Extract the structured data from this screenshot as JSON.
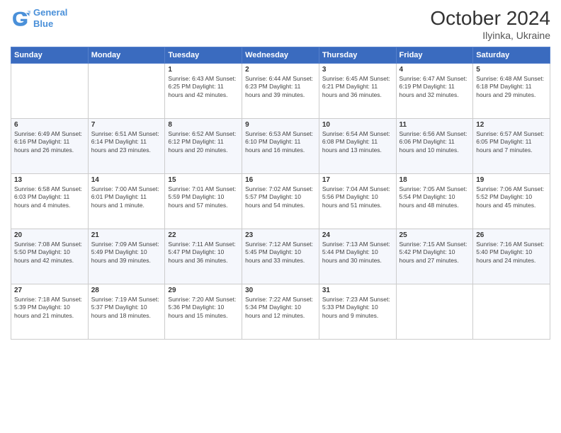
{
  "header": {
    "logo_line1": "General",
    "logo_line2": "Blue",
    "month": "October 2024",
    "location": "Ilyinka, Ukraine"
  },
  "days_of_week": [
    "Sunday",
    "Monday",
    "Tuesday",
    "Wednesday",
    "Thursday",
    "Friday",
    "Saturday"
  ],
  "weeks": [
    [
      {
        "day": "",
        "info": ""
      },
      {
        "day": "",
        "info": ""
      },
      {
        "day": "1",
        "info": "Sunrise: 6:43 AM\nSunset: 6:25 PM\nDaylight: 11 hours and 42 minutes."
      },
      {
        "day": "2",
        "info": "Sunrise: 6:44 AM\nSunset: 6:23 PM\nDaylight: 11 hours and 39 minutes."
      },
      {
        "day": "3",
        "info": "Sunrise: 6:45 AM\nSunset: 6:21 PM\nDaylight: 11 hours and 36 minutes."
      },
      {
        "day": "4",
        "info": "Sunrise: 6:47 AM\nSunset: 6:19 PM\nDaylight: 11 hours and 32 minutes."
      },
      {
        "day": "5",
        "info": "Sunrise: 6:48 AM\nSunset: 6:18 PM\nDaylight: 11 hours and 29 minutes."
      }
    ],
    [
      {
        "day": "6",
        "info": "Sunrise: 6:49 AM\nSunset: 6:16 PM\nDaylight: 11 hours and 26 minutes."
      },
      {
        "day": "7",
        "info": "Sunrise: 6:51 AM\nSunset: 6:14 PM\nDaylight: 11 hours and 23 minutes."
      },
      {
        "day": "8",
        "info": "Sunrise: 6:52 AM\nSunset: 6:12 PM\nDaylight: 11 hours and 20 minutes."
      },
      {
        "day": "9",
        "info": "Sunrise: 6:53 AM\nSunset: 6:10 PM\nDaylight: 11 hours and 16 minutes."
      },
      {
        "day": "10",
        "info": "Sunrise: 6:54 AM\nSunset: 6:08 PM\nDaylight: 11 hours and 13 minutes."
      },
      {
        "day": "11",
        "info": "Sunrise: 6:56 AM\nSunset: 6:06 PM\nDaylight: 11 hours and 10 minutes."
      },
      {
        "day": "12",
        "info": "Sunrise: 6:57 AM\nSunset: 6:05 PM\nDaylight: 11 hours and 7 minutes."
      }
    ],
    [
      {
        "day": "13",
        "info": "Sunrise: 6:58 AM\nSunset: 6:03 PM\nDaylight: 11 hours and 4 minutes."
      },
      {
        "day": "14",
        "info": "Sunrise: 7:00 AM\nSunset: 6:01 PM\nDaylight: 11 hours and 1 minute."
      },
      {
        "day": "15",
        "info": "Sunrise: 7:01 AM\nSunset: 5:59 PM\nDaylight: 10 hours and 57 minutes."
      },
      {
        "day": "16",
        "info": "Sunrise: 7:02 AM\nSunset: 5:57 PM\nDaylight: 10 hours and 54 minutes."
      },
      {
        "day": "17",
        "info": "Sunrise: 7:04 AM\nSunset: 5:56 PM\nDaylight: 10 hours and 51 minutes."
      },
      {
        "day": "18",
        "info": "Sunrise: 7:05 AM\nSunset: 5:54 PM\nDaylight: 10 hours and 48 minutes."
      },
      {
        "day": "19",
        "info": "Sunrise: 7:06 AM\nSunset: 5:52 PM\nDaylight: 10 hours and 45 minutes."
      }
    ],
    [
      {
        "day": "20",
        "info": "Sunrise: 7:08 AM\nSunset: 5:50 PM\nDaylight: 10 hours and 42 minutes."
      },
      {
        "day": "21",
        "info": "Sunrise: 7:09 AM\nSunset: 5:49 PM\nDaylight: 10 hours and 39 minutes."
      },
      {
        "day": "22",
        "info": "Sunrise: 7:11 AM\nSunset: 5:47 PM\nDaylight: 10 hours and 36 minutes."
      },
      {
        "day": "23",
        "info": "Sunrise: 7:12 AM\nSunset: 5:45 PM\nDaylight: 10 hours and 33 minutes."
      },
      {
        "day": "24",
        "info": "Sunrise: 7:13 AM\nSunset: 5:44 PM\nDaylight: 10 hours and 30 minutes."
      },
      {
        "day": "25",
        "info": "Sunrise: 7:15 AM\nSunset: 5:42 PM\nDaylight: 10 hours and 27 minutes."
      },
      {
        "day": "26",
        "info": "Sunrise: 7:16 AM\nSunset: 5:40 PM\nDaylight: 10 hours and 24 minutes."
      }
    ],
    [
      {
        "day": "27",
        "info": "Sunrise: 7:18 AM\nSunset: 5:39 PM\nDaylight: 10 hours and 21 minutes."
      },
      {
        "day": "28",
        "info": "Sunrise: 7:19 AM\nSunset: 5:37 PM\nDaylight: 10 hours and 18 minutes."
      },
      {
        "day": "29",
        "info": "Sunrise: 7:20 AM\nSunset: 5:36 PM\nDaylight: 10 hours and 15 minutes."
      },
      {
        "day": "30",
        "info": "Sunrise: 7:22 AM\nSunset: 5:34 PM\nDaylight: 10 hours and 12 minutes."
      },
      {
        "day": "31",
        "info": "Sunrise: 7:23 AM\nSunset: 5:33 PM\nDaylight: 10 hours and 9 minutes."
      },
      {
        "day": "",
        "info": ""
      },
      {
        "day": "",
        "info": ""
      }
    ]
  ]
}
